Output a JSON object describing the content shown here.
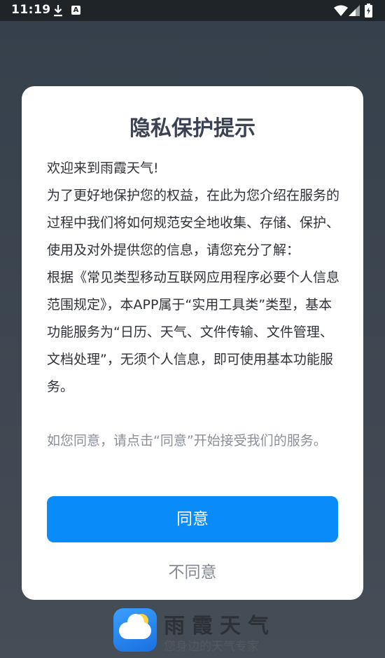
{
  "status_bar": {
    "time": "11:19",
    "icons": [
      "download-icon",
      "a-icon",
      "wifi-icon",
      "signal-icon",
      "battery-icon"
    ],
    "a_glyph": "A"
  },
  "background": {
    "app_name": "雨霞天气",
    "slogan": "您身边的天气专家"
  },
  "dialog": {
    "title": "隐私保护提示",
    "body_paragraphs": [
      "欢迎来到雨霞天气!",
      "为了更好地保护您的权益，在此为您介绍在服务的过程中我们将如何规范安全地收集、存储、保护、使用及对外提供您的信息，请您充分了解：",
      "根据《常见类型移动互联网应用程序必要个人信息范围规定》，本APP属于“实用工具类”类型，基本功能服务为“日历、天气、文件传输、文件管理、文档处理”，无须个人信息，即可使用基本功能服务。"
    ],
    "hint": "如您同意，请点击“同意”开始接受我们的服务。",
    "agree_label": "同意",
    "disagree_label": "不同意"
  },
  "colors": {
    "accent": "#0a8bfa",
    "title": "#3b4251",
    "hint": "#8a8f99",
    "overlay": "#3d4650"
  }
}
